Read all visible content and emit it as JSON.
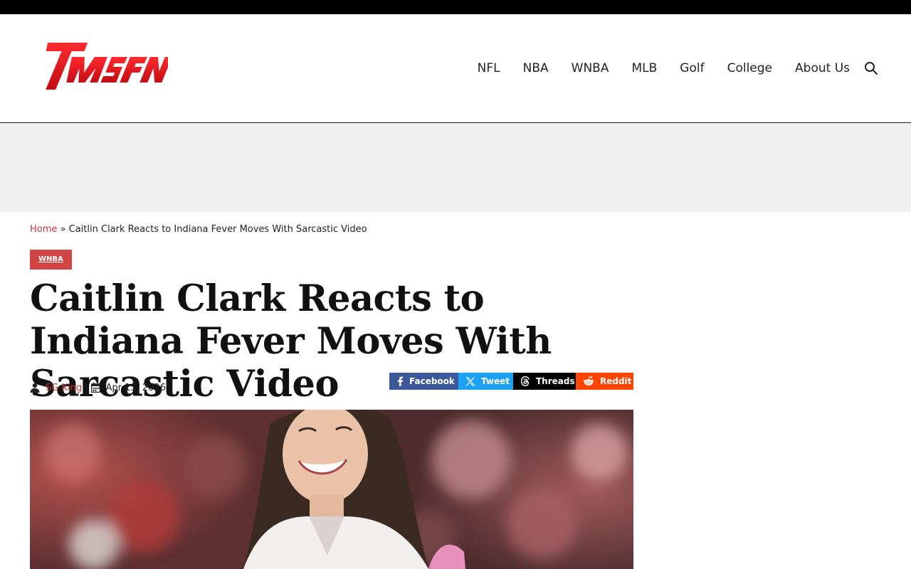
{
  "brand": {
    "logo_text": "TMSFN",
    "accent": "#e31b23"
  },
  "nav": {
    "items": [
      {
        "label": "NFL"
      },
      {
        "label": "NBA"
      },
      {
        "label": "WNBA"
      },
      {
        "label": "MLB"
      },
      {
        "label": "Golf"
      },
      {
        "label": "College"
      },
      {
        "label": "About Us"
      }
    ],
    "search_icon": "search-icon"
  },
  "breadcrumb": {
    "home": "Home",
    "separator": "»",
    "current": "Caitlin Clark Reacts to Indiana Fever Moves With Sarcastic Video"
  },
  "article": {
    "category": "WNBA",
    "title": "Caitlin Clark Reacts to Indiana Fever Moves With Sarcastic Video",
    "author": "SG King",
    "meta_separator": "|",
    "date": "Apr 13, 2026"
  },
  "share": {
    "facebook": "Facebook",
    "twitter": "Tweet",
    "threads": "Threads",
    "reddit": "Reddit"
  },
  "colors": {
    "link_red": "#c8353a",
    "category_bg": "#d24545",
    "facebook": "#3b5998",
    "twitter": "#1da1f2",
    "threads": "#000000",
    "reddit": "#ff4500",
    "ad_band": "#f0f0f0"
  }
}
